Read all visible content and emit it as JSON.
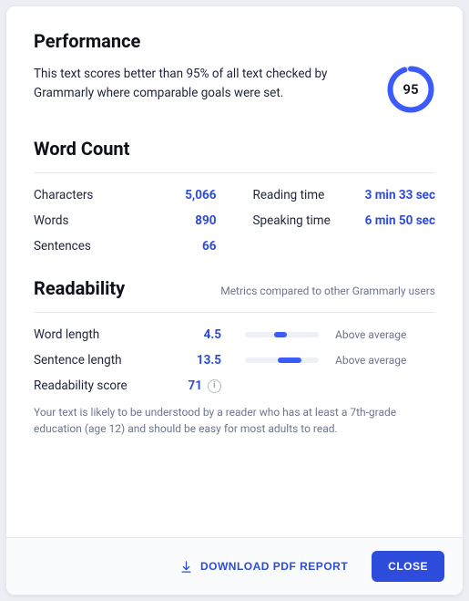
{
  "performance": {
    "title": "Performance",
    "description": "This text scores better than 95% of all text checked by Grammarly where comparable goals were set.",
    "score": 95,
    "score_pct": 0.95
  },
  "word_count": {
    "title": "Word Count",
    "items_left": [
      {
        "label": "Characters",
        "value": "5,066"
      },
      {
        "label": "Words",
        "value": "890"
      },
      {
        "label": "Sentences",
        "value": "66"
      }
    ],
    "items_right": [
      {
        "label": "Reading time",
        "value": "3 min 33 sec"
      },
      {
        "label": "Speaking time",
        "value": "6 min 50 sec"
      }
    ]
  },
  "readability": {
    "title": "Readability",
    "subtitle": "Metrics compared to other Grammarly users",
    "rows": [
      {
        "label": "Word length",
        "value": "4.5",
        "bar_start": 40,
        "bar_end": 57,
        "comment": "Above average"
      },
      {
        "label": "Sentence length",
        "value": "13.5",
        "bar_start": 44,
        "bar_end": 76,
        "comment": "Above average"
      }
    ],
    "score_label": "Readability score",
    "score_value": "71",
    "note": "Your text is likely to be understood by a reader who has at least a 7th-grade education (age 12) and should be easy for most adults to read."
  },
  "footer": {
    "download_label": "DOWNLOAD PDF REPORT",
    "close_label": "CLOSE"
  }
}
